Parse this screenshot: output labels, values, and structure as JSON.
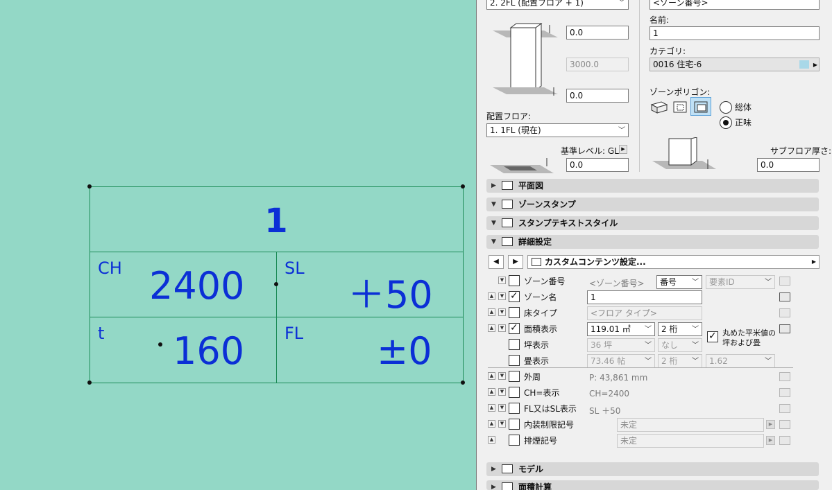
{
  "stamp": {
    "zone_number": "1",
    "ch_label": "CH",
    "ch_value": "2400",
    "sl_label": "SL",
    "sl_value": "＋50",
    "t_label": "t",
    "t_value": "160",
    "fl_label": "FL",
    "fl_value": "±0"
  },
  "geometry": {
    "top_floor_select": "2. 2FL (配置フロア + 1)",
    "top_offset": "0.0",
    "height": "3000.0",
    "bottom_offset": "0.0",
    "home_floor_label": "配置フロア:",
    "home_floor_select": "1. 1FL (現在)",
    "ref_level_label": "基準レベル: GL",
    "ref_level_value": "0.0"
  },
  "zone": {
    "number_value": "<ゾーン番号>",
    "name_label": "名前:",
    "name_value": "1",
    "category_label": "カテゴリ:",
    "category_value": "0016  住宅-6",
    "category_color": "#a9d8e8",
    "polygon_label": "ゾーンポリゴン:",
    "radio_gross": "総体",
    "radio_net": "正味",
    "selected_radio": "正味",
    "subfloor_label": "サブフロア厚さ:",
    "subfloor_value": "0.0"
  },
  "sections": {
    "floor_plan": "平面図",
    "zone_stamp": "ゾーンスタンプ",
    "stamp_text_style": "スタンプテキストスタイル",
    "details": "詳細設定",
    "model": "モデル",
    "area_calc": "面積計算"
  },
  "custom_content": {
    "title": "カスタムコンテンツ設定..."
  },
  "rows": [
    {
      "label": "ゾーン番号",
      "checked": false,
      "value": "<ゾーン番号>",
      "select1": "番号",
      "select2": "要素ID"
    },
    {
      "label": "ゾーン名",
      "checked": true,
      "value": "1"
    },
    {
      "label": "床タイプ",
      "checked": false,
      "value": "<フロア タイプ>"
    },
    {
      "label": "面積表示",
      "checked": true,
      "select1": "119.01 ㎡",
      "select2": "2 桁"
    },
    {
      "label": "坪表示",
      "checked": false,
      "select1": "36 坪",
      "select2": "なし"
    },
    {
      "label": "畳表示",
      "checked": false,
      "select1": "73.46 帖",
      "select2": "2 桁",
      "select3": "1.62"
    },
    {
      "label": "外周",
      "checked": false,
      "value": "P: 43,861 mm"
    },
    {
      "label": "CH=表示",
      "checked": false,
      "value": "CH=2400"
    },
    {
      "label": "FL又はSL表示",
      "checked": false,
      "value": "SL ＋50"
    },
    {
      "label": "内装制限記号",
      "checked": false,
      "value": "未定"
    },
    {
      "label": "排煙記号",
      "checked": false,
      "value": "未定"
    }
  ],
  "rounded_option": {
    "checked": true,
    "line1": "丸めた平米値の",
    "line2": "坪および畳"
  }
}
